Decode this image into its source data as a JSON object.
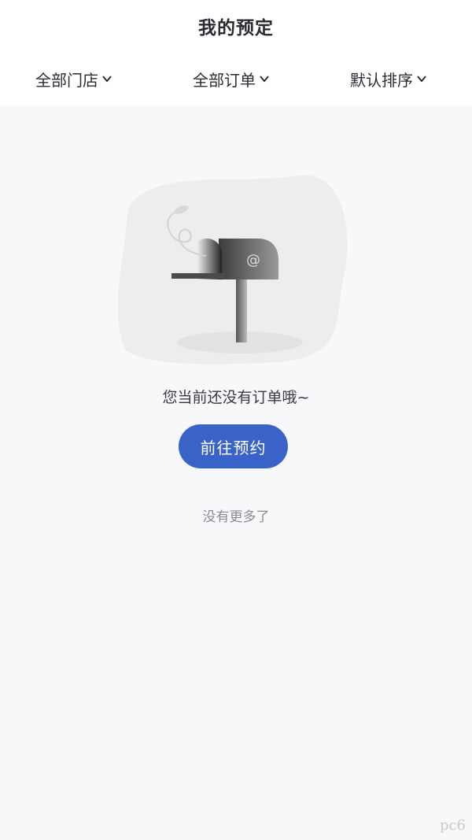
{
  "header": {
    "title": "我的预定"
  },
  "filters": [
    {
      "label": "全部门店",
      "icon": "chevron-down-icon"
    },
    {
      "label": "全部订单",
      "icon": "chevron-down-icon"
    },
    {
      "label": "默认排序",
      "icon": "chevron-down-icon"
    }
  ],
  "empty_state": {
    "illustration": "mailbox-illustration",
    "message": "您当前还没有订单哦~",
    "cta_label": "前往预约",
    "footer": "没有更多了"
  },
  "watermark": {
    "text": "pc6"
  },
  "colors": {
    "accent": "#3a63c9",
    "background": "#f7f8fa",
    "header_bg": "#ffffff"
  }
}
